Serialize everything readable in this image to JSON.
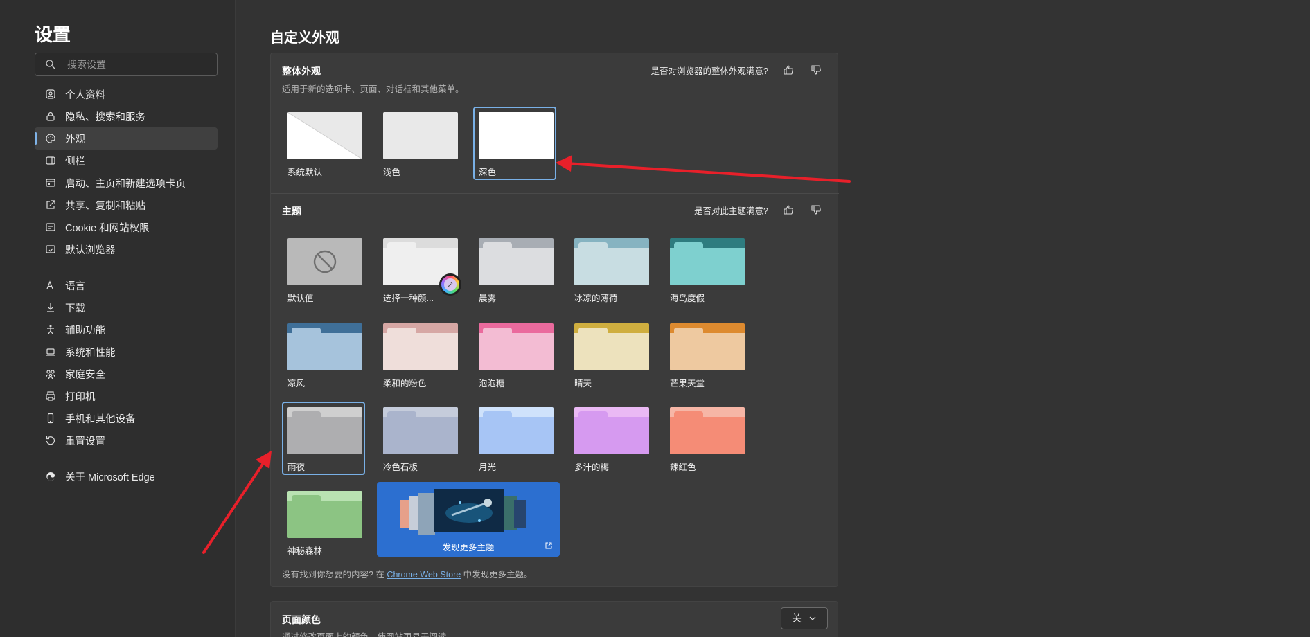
{
  "sidebar": {
    "title": "设置",
    "search_placeholder": "搜索设置",
    "items": [
      {
        "label": "个人资料",
        "icon": "profile-icon"
      },
      {
        "label": "隐私、搜索和服务",
        "icon": "lock-icon"
      },
      {
        "label": "外观",
        "icon": "palette-icon",
        "active": true
      },
      {
        "label": "侧栏",
        "icon": "sidebar-icon"
      },
      {
        "label": "启动、主页和新建选项卡页",
        "icon": "home-tabs-icon"
      },
      {
        "label": "共享、复制和粘贴",
        "icon": "share-icon"
      },
      {
        "label": "Cookie 和网站权限",
        "icon": "site-permissions-icon"
      },
      {
        "label": "默认浏览器",
        "icon": "default-browser-icon"
      },
      {
        "label": "语言",
        "icon": "language-icon"
      },
      {
        "label": "下载",
        "icon": "download-icon"
      },
      {
        "label": "辅助功能",
        "icon": "accessibility-icon"
      },
      {
        "label": "系统和性能",
        "icon": "laptop-icon"
      },
      {
        "label": "家庭安全",
        "icon": "family-icon"
      },
      {
        "label": "打印机",
        "icon": "printer-icon"
      },
      {
        "label": "手机和其他设备",
        "icon": "phone-icon"
      },
      {
        "label": "重置设置",
        "icon": "reset-icon"
      },
      {
        "label": "关于 Microsoft Edge",
        "icon": "edge-logo-icon"
      }
    ]
  },
  "main": {
    "title": "自定义外观",
    "overall": {
      "title": "整体外观",
      "subtitle": "适用于新的选项卡、页面、对话框和其他菜单。",
      "feedback": "是否对浏览器的整体外观满意?",
      "options": [
        {
          "label": "系统默认"
        },
        {
          "label": "浅色"
        },
        {
          "label": "深色",
          "selected": true
        }
      ]
    },
    "themes": {
      "title": "主题",
      "feedback": "是否对此主题满意?",
      "items": [
        {
          "label": "默认值",
          "tab": "#c6c6c6",
          "body": "#b9b9b9"
        },
        {
          "label": "选择一种颜...",
          "tab": "#dcdcdc",
          "body": "#efefef"
        },
        {
          "label": "晨雾",
          "tab": "#a8adb4",
          "body": "#dcdde0"
        },
        {
          "label": "冰凉的薄荷",
          "tab": "#86b3c1",
          "body": "#c8dde2"
        },
        {
          "label": "海岛度假",
          "tab": "#2e7c7f",
          "body": "#7ed0cf"
        },
        {
          "label": "凉风",
          "tab": "#3f6f98",
          "body": "#a6c3dc"
        },
        {
          "label": "柔和的粉色",
          "tab": "#d6a7a4",
          "body": "#efdeda"
        },
        {
          "label": "泡泡糖",
          "tab": "#ea6a9d",
          "body": "#f3bcd3"
        },
        {
          "label": "晴天",
          "tab": "#cfae3f",
          "body": "#ede2bd"
        },
        {
          "label": "芒果天堂",
          "tab": "#dd8a2f",
          "body": "#eec9a0"
        },
        {
          "label": "雨夜",
          "tab": "#cfcfcf",
          "body": "#aeaeb0",
          "selected": true
        },
        {
          "label": "冷色石板",
          "tab": "#c5ccdb",
          "body": "#aab4cc"
        },
        {
          "label": "月光",
          "tab": "#cfe2fb",
          "body": "#a7c5f5"
        },
        {
          "label": "多汁的梅",
          "tab": "#eab9f4",
          "body": "#d69af0"
        },
        {
          "label": "辣红色",
          "tab": "#f6b6a6",
          "body": "#f58c76"
        },
        {
          "label": "神秘森林",
          "tab": "#b9e2b2",
          "body": "#8cc483"
        }
      ],
      "discover_label": "发现更多主题",
      "footnote_before": "没有找到你想要的内容? 在",
      "footnote_link": "Chrome Web Store",
      "footnote_after": "中发现更多主题。"
    },
    "page_color": {
      "title": "页面颜色",
      "subtitle": "通过修改页面上的颜色，使网站更易于阅读",
      "select_value": "关"
    }
  },
  "colors": {
    "accent": "#79b0e6",
    "arrow": "#e8202a",
    "discover_bg": "#2c6fd0"
  }
}
